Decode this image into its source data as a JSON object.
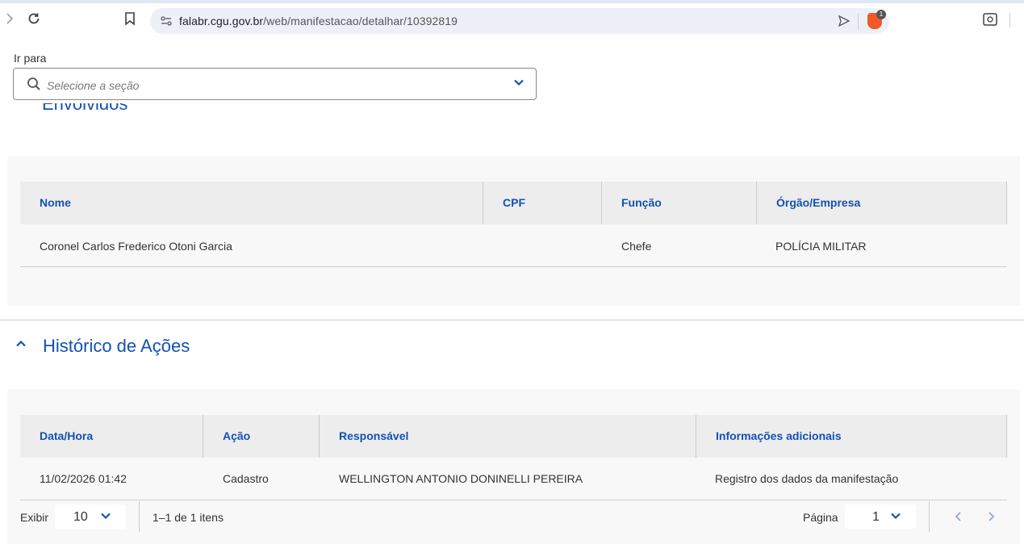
{
  "browser": {
    "url_host": "falabr.cgu.gov.br",
    "url_path": "/web/manifestacao/detalhar/10392819",
    "extension_badge": "1"
  },
  "goto": {
    "label": "Ir para",
    "placeholder": "Selecione a seção"
  },
  "envolvidos": {
    "section_title_partial": "Envolvidos",
    "columns": [
      "Nome",
      "CPF",
      "Função",
      "Órgão/Empresa"
    ],
    "rows": [
      [
        "Coronel Carlos Frederico Otoni Garcia",
        "",
        "Chefe",
        "POLÍCIA MILITAR"
      ]
    ]
  },
  "historico": {
    "section_title": "Histórico de Ações",
    "columns": [
      "Data/Hora",
      "Ação",
      "Responsável",
      "Informações adicionais"
    ],
    "rows": [
      [
        "11/02/2026 01:42",
        "Cadastro",
        "WELLINGTON ANTONIO DONINELLI PEREIRA",
        "Registro dos dados da manifestação"
      ]
    ],
    "pager": {
      "show_label": "Exibir",
      "page_size": "10",
      "range_text": "1–1 de 1 itens",
      "page_label": "Página",
      "page_value": "1"
    }
  },
  "colors": {
    "primary": "#1351b4",
    "header_bg": "#ededed",
    "card_bg": "#f8f8f8"
  }
}
